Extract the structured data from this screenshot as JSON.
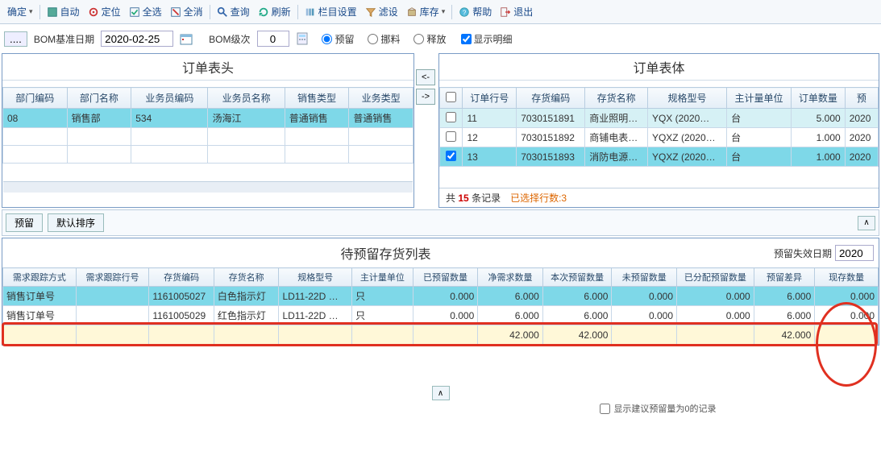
{
  "toolbar": {
    "confirm": "确定",
    "auto": "自动",
    "locate": "定位",
    "selAll": "全选",
    "selNone": "全消",
    "query": "查询",
    "refresh": "刷新",
    "colSet": "栏目设置",
    "filter": "滤设",
    "stock": "库存",
    "help": "帮助",
    "exit": "退出"
  },
  "params": {
    "bomDateLabel": "BOM基准日期",
    "bomDate": "2020-02-25",
    "bomLevelLabel": "BOM级次",
    "bomLevel": "0",
    "r1": "预留",
    "r2": "挪料",
    "r3": "释放",
    "showDetail": "显示明细"
  },
  "leftPanel": {
    "title": "订单表头",
    "cols": [
      "部门编码",
      "部门名称",
      "业务员编码",
      "业务员名称",
      "销售类型",
      "业务类型"
    ],
    "rows": [
      [
        "08",
        "销售部",
        "534",
        "汤海江",
        "普通销售",
        "普通销售"
      ]
    ]
  },
  "midBtns": {
    "lt": "<-",
    "gt": "->"
  },
  "rightPanel": {
    "title": "订单表体",
    "cols": [
      "",
      "订单行号",
      "存货编码",
      "存货名称",
      "规格型号",
      "主计量单位",
      "订单数量",
      "预"
    ],
    "rows": [
      {
        "chk": false,
        "c": [
          "11",
          "7030151891",
          "商业照明…",
          "YQX (2020…",
          "台",
          "5.000",
          "2020"
        ],
        "cls": "alt"
      },
      {
        "chk": false,
        "c": [
          "12",
          "7030151892",
          "商铺电表…",
          "YQXZ (2020…",
          "台",
          "1.000",
          "2020"
        ],
        "cls": ""
      },
      {
        "chk": true,
        "c": [
          "13",
          "7030151893",
          "消防电源…",
          "YQXZ (2020…",
          "台",
          "1.000",
          "2020"
        ],
        "cls": "sel"
      }
    ],
    "recTotal": "15",
    "recLabelA": "共",
    "recLabelB": "条记录",
    "selRows": "已选择行数:3"
  },
  "subBar": {
    "reserve": "预留",
    "defSort": "默认排序"
  },
  "listSection": {
    "title": "待预留存货列表",
    "expLabel": "预留失效日期",
    "expVal": "2020",
    "cols": [
      "需求跟踪方式",
      "需求跟踪行号",
      "存货编码",
      "存货名称",
      "规格型号",
      "主计量单位",
      "已预留数量",
      "净需求数量",
      "本次预留数量",
      "未预留数量",
      "已分配预留数量",
      "预留差异",
      "现存数量"
    ],
    "rows": [
      {
        "cls": "hl",
        "c": [
          "销售订单号",
          "",
          "1161005027",
          "白色指示灯",
          "LD11-22D …",
          "只",
          "0.000",
          "6.000",
          "6.000",
          "0.000",
          "0.000",
          "6.000",
          "0.000"
        ]
      },
      {
        "cls": "",
        "c": [
          "销售订单号",
          "",
          "1161005029",
          "红色指示灯",
          "LD11-22D …",
          "只",
          "0.000",
          "6.000",
          "6.000",
          "0.000",
          "0.000",
          "6.000",
          "0.000"
        ]
      }
    ],
    "sum": [
      "",
      "",
      "",
      "",
      "",
      "",
      "",
      "42.000",
      "42.000",
      "",
      "",
      "42.000",
      ""
    ]
  },
  "footer": {
    "caret": "∧",
    "chkLabel": "显示建议预留量为0的记录"
  }
}
